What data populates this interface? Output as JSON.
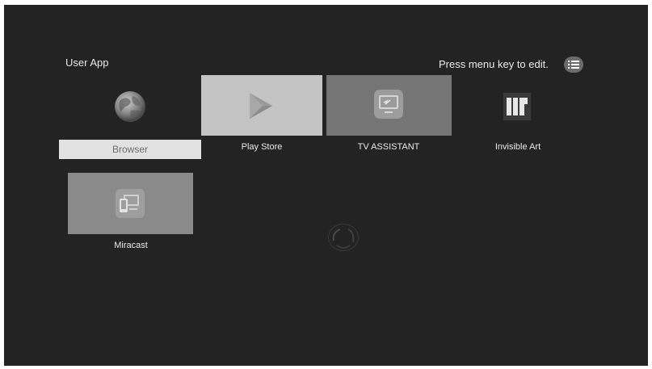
{
  "section": {
    "title": "User App"
  },
  "hint": {
    "text": "Press menu key to edit."
  },
  "icons": {
    "menu": "list-icon",
    "loader": "spinner-icon"
  },
  "apps": [
    {
      "label": "Browser",
      "icon": "globe-icon"
    },
    {
      "label": "Play Store",
      "icon": "play-store-icon"
    },
    {
      "label": "TV ASSISTANT",
      "icon": "tv-assistant-icon"
    },
    {
      "label": "Invisible Art",
      "icon": "invisible-art-icon"
    },
    {
      "label": "Miracast",
      "icon": "miracast-icon"
    }
  ],
  "colors": {
    "background": "#232323",
    "tile_light": "#c4c4c4",
    "tile_mid": "#757575",
    "tile_miracast": "#8a8a8a",
    "selected_bar": "#e2e2e2"
  }
}
